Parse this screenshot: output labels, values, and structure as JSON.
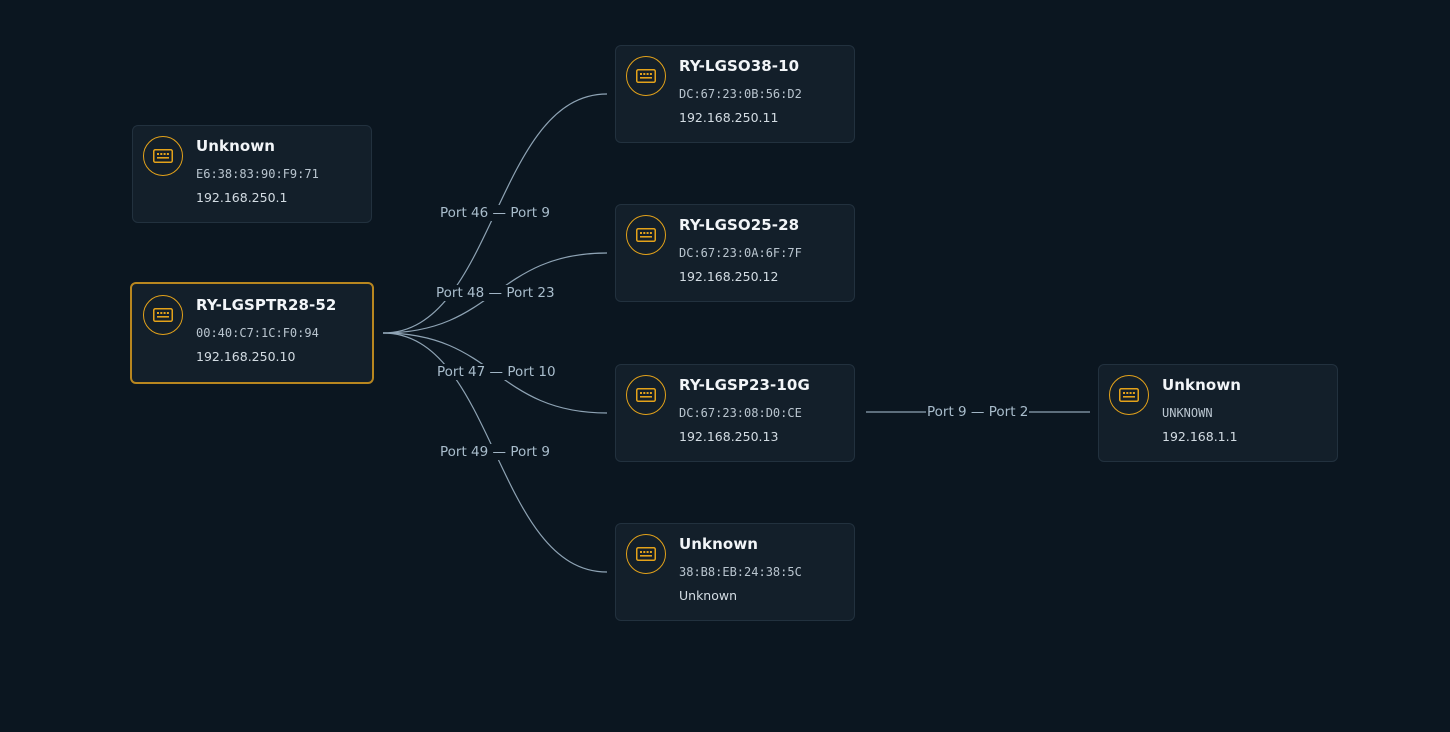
{
  "colors": {
    "background": "#0b1620",
    "node_fill": "#131f2a",
    "node_border": "#22313e",
    "selected_border": "#b8861f",
    "icon_accent": "#e3a21a",
    "link_stroke": "#8ea3b4",
    "label_text": "#a9bdcc"
  },
  "nodes": [
    {
      "id": "unknown-gateway",
      "icon": "network-switch-icon",
      "name": "Unknown",
      "mac": "E6:38:83:90:F9:71",
      "ip": "192.168.250.1",
      "selected": false
    },
    {
      "id": "ry-lgsptr28-52",
      "icon": "network-switch-icon",
      "name": "RY-LGSPTR28-52",
      "mac": "00:40:C7:1C:F0:94",
      "ip": "192.168.250.10",
      "selected": true
    },
    {
      "id": "ry-lgso38-10",
      "icon": "network-switch-icon",
      "name": "RY-LGSO38-10",
      "mac": "DC:67:23:0B:56:D2",
      "ip": "192.168.250.11",
      "selected": false
    },
    {
      "id": "ry-lgso25-28",
      "icon": "network-switch-icon",
      "name": "RY-LGSO25-28",
      "mac": "DC:67:23:0A:6F:7F",
      "ip": "192.168.250.12",
      "selected": false
    },
    {
      "id": "ry-lgsp23-10g",
      "icon": "network-switch-icon",
      "name": "RY-LGSP23-10G",
      "mac": "DC:67:23:08:D0:CE",
      "ip": "192.168.250.13",
      "selected": false
    },
    {
      "id": "unknown-bottom",
      "icon": "network-switch-icon",
      "name": "Unknown",
      "mac": "38:B8:EB:24:38:5C",
      "ip": "Unknown",
      "selected": false
    },
    {
      "id": "unknown-right",
      "icon": "network-switch-icon",
      "name": "Unknown",
      "mac": "UNKNOWN",
      "ip": "192.168.1.1",
      "selected": false
    }
  ],
  "links": [
    {
      "from": "ry-lgsptr28-52",
      "to": "ry-lgso38-10",
      "label": "Port 46 — Port 9"
    },
    {
      "from": "ry-lgsptr28-52",
      "to": "ry-lgso25-28",
      "label": "Port 48 — Port 23"
    },
    {
      "from": "ry-lgsptr28-52",
      "to": "ry-lgsp23-10g",
      "label": "Port 47 — Port 10"
    },
    {
      "from": "ry-lgsptr28-52",
      "to": "unknown-bottom",
      "label": "Port 49 — Port 9"
    },
    {
      "from": "ry-lgsp23-10g",
      "to": "unknown-right",
      "label": "Port 9 — Port 2"
    }
  ]
}
